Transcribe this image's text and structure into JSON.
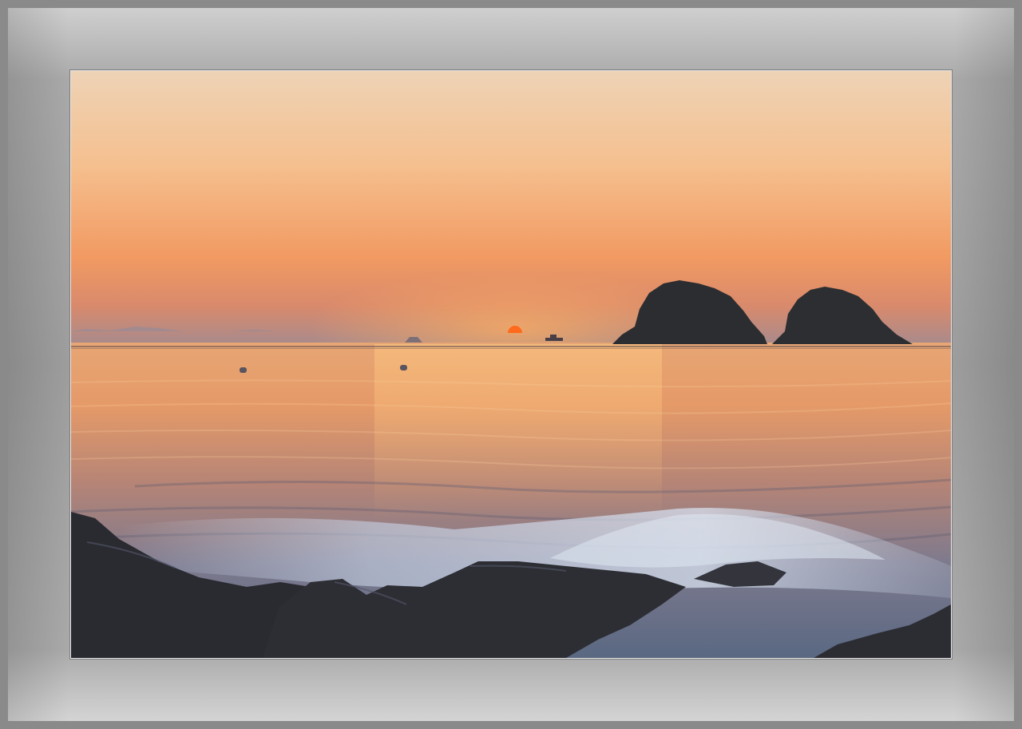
{
  "image": {
    "subject": "sunset-seascape",
    "colors": {
      "sky_top": "#eed2b4",
      "sky_mid": "#f6b07c",
      "sky_low": "#ef8f5a",
      "horizon_haze": "#b78e86",
      "sun": "#ff7a2a",
      "sea_near_horizon": "#e9a070",
      "sea_mid": "#9a7c86",
      "sea_blue": "#5d6f8a",
      "rock": "#2a2b31",
      "island": "#2b2d30",
      "frame": "#a0a0a0"
    }
  }
}
